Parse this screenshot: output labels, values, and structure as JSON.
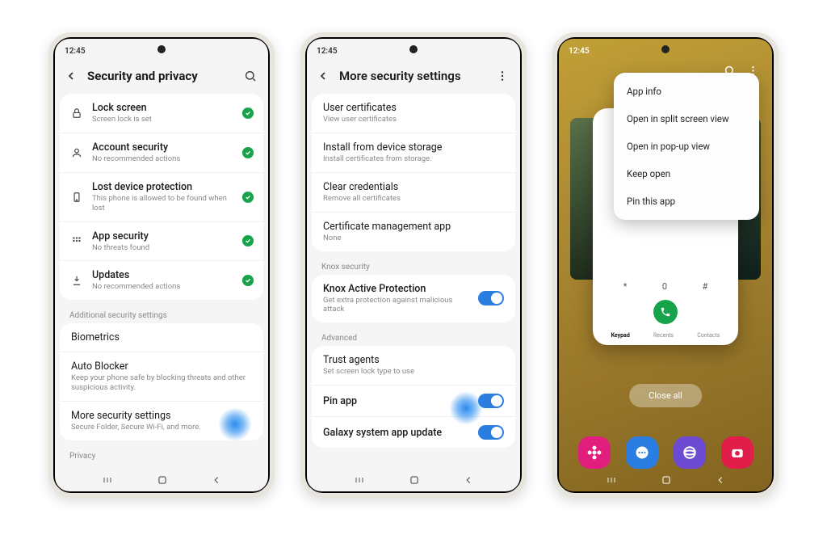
{
  "phone1": {
    "time": "12:45",
    "header_title": "Security and privacy",
    "rows": [
      {
        "icon": "lock",
        "title": "Lock screen",
        "sub": "Screen lock is set"
      },
      {
        "icon": "account",
        "title": "Account security",
        "sub": "No recommended actions"
      },
      {
        "icon": "locate",
        "title": "Lost device protection",
        "sub": "This phone is allowed to be found when lost"
      },
      {
        "icon": "apps",
        "title": "App security",
        "sub": "No threats found"
      },
      {
        "icon": "update",
        "title": "Updates",
        "sub": "No recommended actions"
      }
    ],
    "section_additional": "Additional security settings",
    "additional": [
      {
        "title": "Biometrics",
        "sub": ""
      },
      {
        "title": "Auto Blocker",
        "sub": "Keep your phone safe by blocking threats and other suspicious activity."
      },
      {
        "title": "More security settings",
        "sub": "Secure Folder, Secure Wi-Fi, and more."
      }
    ],
    "privacy_label": "Privacy"
  },
  "phone2": {
    "time": "12:45",
    "header_title": "More security settings",
    "cert_rows": [
      {
        "title": "User certificates",
        "sub": "View user certificates"
      },
      {
        "title": "Install from device storage",
        "sub": "Install certificates from storage."
      },
      {
        "title": "Clear credentials",
        "sub": "Remove all certificates"
      },
      {
        "title": "Certificate management app",
        "sub": "None"
      }
    ],
    "knox_label": "Knox security",
    "knox_row": {
      "title": "Knox Active Protection",
      "sub": "Get extra protection against malicious attack"
    },
    "advanced_label": "Advanced",
    "adv_rows": [
      {
        "title": "Trust agents",
        "sub": "Set screen lock type to use"
      },
      {
        "title": "Pin app",
        "sub": ""
      },
      {
        "title": "Galaxy system app update",
        "sub": ""
      }
    ]
  },
  "phone3": {
    "time": "12:45",
    "menu": [
      "App info",
      "Open in split screen view",
      "Open in pop-up view",
      "Keep open",
      "Pin this app"
    ],
    "dialer_keys_row": [
      "*",
      "0",
      "#"
    ],
    "dialer_tabs": [
      "Keypad",
      "Recents",
      "Contacts"
    ],
    "close_all": "Close all"
  }
}
